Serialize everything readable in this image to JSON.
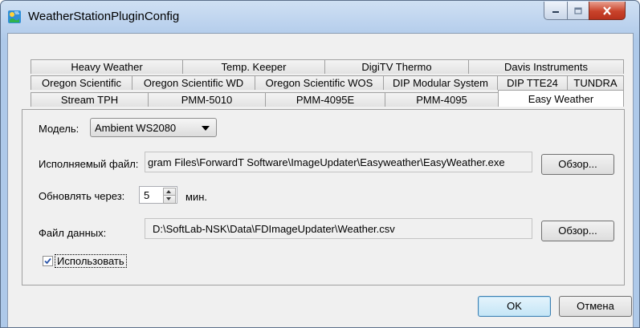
{
  "window": {
    "title": "WeatherStationPluginConfig"
  },
  "tabs": {
    "row1": [
      "Heavy Weather",
      "Temp. Keeper",
      "DigiTV Thermo",
      "Davis Instruments"
    ],
    "row2": [
      "Oregon Scientific",
      "Oregon Scientific WD",
      "Oregon Scientific WOS",
      "DIP Modular System",
      "DIP TTE24",
      "TUNDRA"
    ],
    "row3": [
      "Stream TPH",
      "PMM-5010",
      "PMM-4095E",
      "PMM-4095",
      "Easy Weather"
    ],
    "active": "Easy Weather"
  },
  "form": {
    "model_label": "Модель:",
    "model_value": "Ambient WS2080",
    "exe_label": "Исполняемый файл:",
    "exe_value": "C:\\Program Files\\ForwardT Software\\ImageUpdater\\Easyweather\\EasyWeather.exe",
    "exe_visible": "gram Files\\ForwardT Software\\ImageUpdater\\Easyweather\\EasyWeather.exe",
    "browse_label": "Обзор...",
    "update_label": "Обновлять через:",
    "update_value": "5",
    "update_unit": "мин.",
    "datafile_label": "Файл данных:",
    "datafile_value": "D:\\SoftLab-NSK\\Data\\FDImageUpdater\\Weather.csv",
    "use_label": "Использовать",
    "use_checked": true
  },
  "buttons": {
    "ok": "OK",
    "cancel": "Отмена"
  },
  "icons": {
    "app": "weather-station-icon",
    "minimize": "minimize-icon",
    "maximize": "maximize-icon",
    "close": "close-icon",
    "check": "check-icon"
  }
}
